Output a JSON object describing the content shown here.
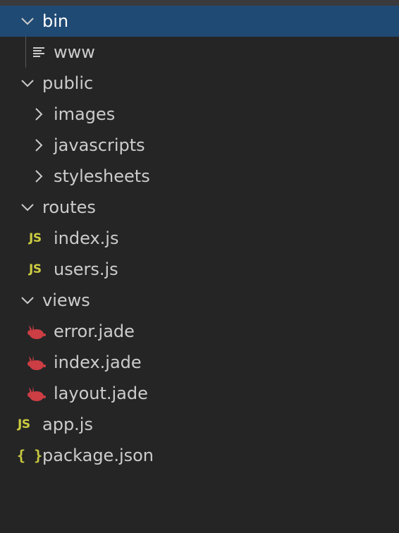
{
  "explorer": {
    "items": [
      {
        "label": "bin",
        "kind": "folder-open",
        "depth": 0,
        "selected": true
      },
      {
        "label": "www",
        "kind": "file-text",
        "depth": 1
      },
      {
        "label": "public",
        "kind": "folder-open",
        "depth": 0
      },
      {
        "label": "images",
        "kind": "folder-closed",
        "depth": 1
      },
      {
        "label": "javascripts",
        "kind": "folder-closed",
        "depth": 1
      },
      {
        "label": "stylesheets",
        "kind": "folder-closed",
        "depth": 1
      },
      {
        "label": "routes",
        "kind": "folder-open",
        "depth": 0
      },
      {
        "label": "index.js",
        "kind": "file-js",
        "depth": 1,
        "icon_text": "JS"
      },
      {
        "label": "users.js",
        "kind": "file-js",
        "depth": 1,
        "icon_text": "JS"
      },
      {
        "label": "views",
        "kind": "folder-open",
        "depth": 0
      },
      {
        "label": "error.jade",
        "kind": "file-jade",
        "depth": 1
      },
      {
        "label": "index.jade",
        "kind": "file-jade",
        "depth": 1
      },
      {
        "label": "layout.jade",
        "kind": "file-jade",
        "depth": 1
      },
      {
        "label": "app.js",
        "kind": "file-js",
        "depth": 0,
        "icon_text": "JS"
      },
      {
        "label": "package.json",
        "kind": "file-json",
        "depth": 0,
        "icon_text": "{ }"
      }
    ]
  },
  "colors": {
    "background": "#252526",
    "selected_row": "#1f4a74",
    "text": "#cccccc",
    "js_icon": "#cbcb41",
    "jade_icon": "#cc3e44"
  }
}
